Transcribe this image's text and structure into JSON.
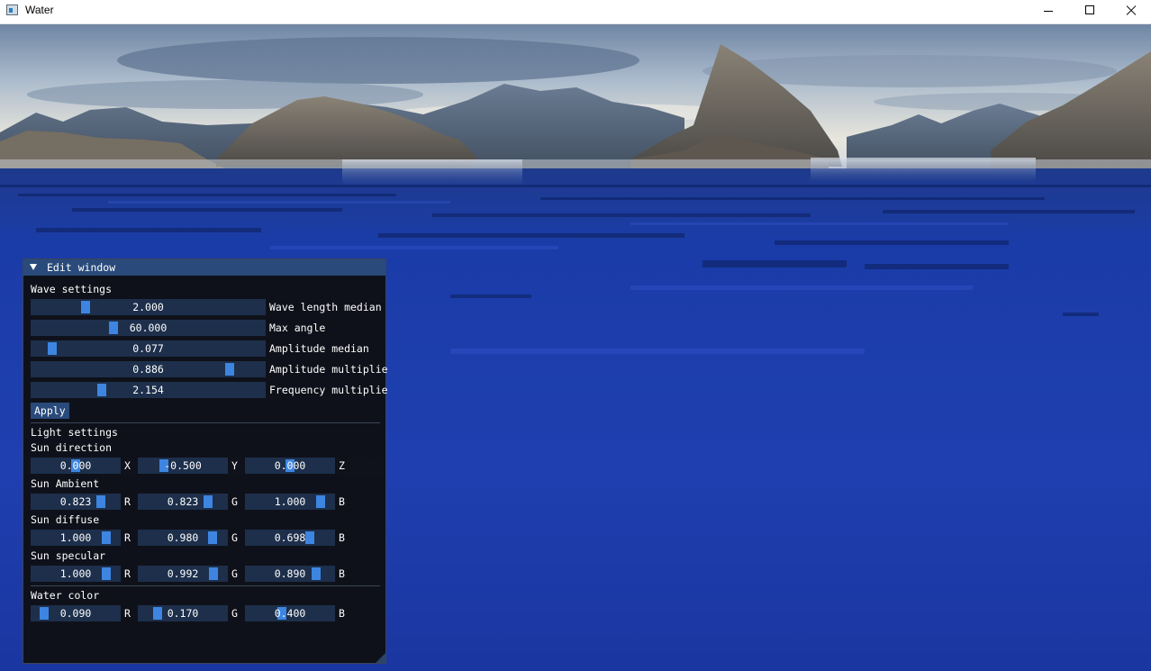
{
  "window": {
    "title": "Water",
    "icon": "app-window-icon"
  },
  "panel": {
    "title": "Edit window",
    "wave": {
      "header": "Wave settings",
      "sliders": [
        {
          "value": "2.000",
          "label": "Wave length median",
          "pos": 0.22
        },
        {
          "value": "60.000",
          "label": "Max angle",
          "pos": 0.345
        },
        {
          "value": "0.077",
          "label": "Amplitude median",
          "pos": 0.07
        },
        {
          "value": "0.886",
          "label": "Amplitude multiplie",
          "pos": 0.865
        },
        {
          "value": "2.154",
          "label": "Frequency multiplie",
          "pos": 0.29
        }
      ],
      "apply_label": "Apply"
    },
    "light": {
      "header": "Light settings",
      "groups": [
        {
          "name": "Sun direction",
          "components": [
            {
              "value": "0.000",
              "axis": "X",
              "pos": 0.5
            },
            {
              "value": "-0.500",
              "axis": "Y",
              "pos": 0.25
            },
            {
              "value": "0.000",
              "axis": "Z",
              "pos": 0.5
            }
          ]
        },
        {
          "name": "Sun Ambient",
          "components": [
            {
              "value": "0.823",
              "axis": "R",
              "pos": 0.823
            },
            {
              "value": "0.823",
              "axis": "G",
              "pos": 0.823
            },
            {
              "value": "1.000",
              "axis": "B",
              "pos": 0.9
            }
          ]
        },
        {
          "name": "Sun diffuse",
          "components": [
            {
              "value": "1.000",
              "axis": "R",
              "pos": 0.9
            },
            {
              "value": "0.980",
              "axis": "G",
              "pos": 0.88
            },
            {
              "value": "0.698",
              "axis": "B",
              "pos": 0.75
            }
          ]
        },
        {
          "name": "Sun specular",
          "components": [
            {
              "value": "1.000",
              "axis": "R",
              "pos": 0.9
            },
            {
              "value": "0.992",
              "axis": "G",
              "pos": 0.89
            },
            {
              "value": "0.890",
              "axis": "B",
              "pos": 0.84
            }
          ]
        }
      ]
    },
    "water": {
      "header": "Water color",
      "components": [
        {
          "value": "0.090",
          "axis": "R",
          "pos": 0.09
        },
        {
          "value": "0.170",
          "axis": "G",
          "pos": 0.17
        },
        {
          "value": "0.400",
          "axis": "B",
          "pos": 0.4
        }
      ]
    }
  },
  "colors": {
    "panel_bg": "#0f0f11",
    "title_active": "#294a7a",
    "frame_bg": "#1d2f4b",
    "slider_grab": "#3d85e0",
    "water": "#1a3aa6",
    "sky": "#9fb2c8"
  }
}
